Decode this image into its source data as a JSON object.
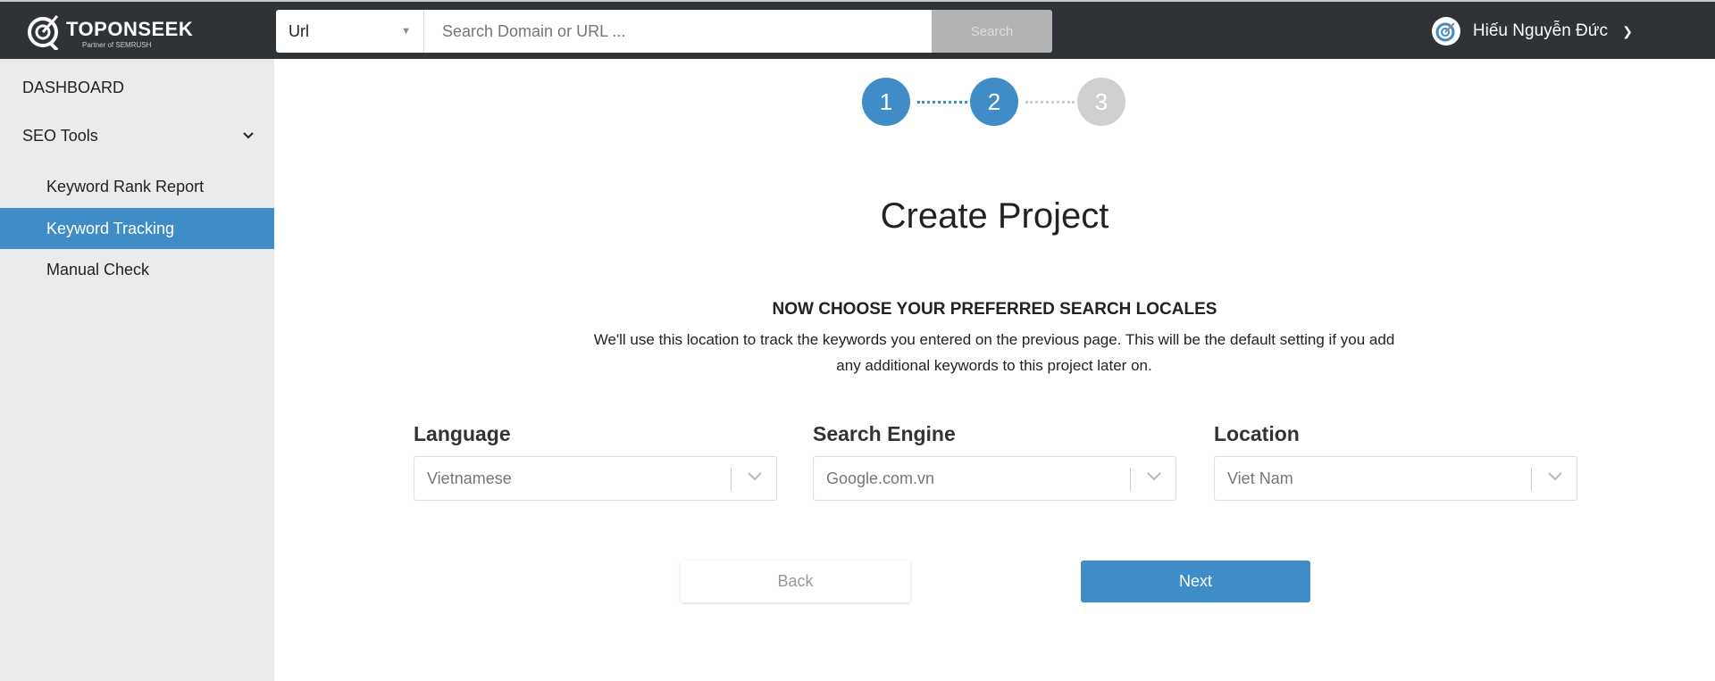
{
  "header": {
    "logo_text": "TOPONSEEK",
    "logo_partner": "Partner of SEMRUSH",
    "search_type": "Url",
    "search_placeholder": "Search Domain or URL ...",
    "search_button": "Search",
    "user_name": "Hiếu Nguyễn Đức"
  },
  "sidebar": {
    "items": [
      {
        "label": "DASHBOARD"
      },
      {
        "label": "SEO Tools"
      },
      {
        "label": "Keyword Rank Report"
      },
      {
        "label": "Keyword Tracking",
        "active": true
      },
      {
        "label": "Manual Check"
      }
    ]
  },
  "steps": {
    "items": [
      "1",
      "2",
      "3"
    ],
    "current": 2
  },
  "main": {
    "title": "Create Project",
    "heading": "NOW CHOOSE YOUR PREFERRED SEARCH LOCALES",
    "description": "We'll use this location to track the keywords you entered on the previous page. This will be the default setting if you add any additional keywords to this project later on.",
    "fields": [
      {
        "label": "Language",
        "value": "Vietnamese"
      },
      {
        "label": "Search Engine",
        "value": "Google.com.vn"
      },
      {
        "label": "Location",
        "value": "Viet Nam"
      }
    ],
    "back": "Back",
    "next": "Next"
  },
  "colors": {
    "accent": "#3f8cc6",
    "header": "#2f3337",
    "sidebar": "#ebebeb",
    "inactive_step": "#d0d0d0"
  }
}
